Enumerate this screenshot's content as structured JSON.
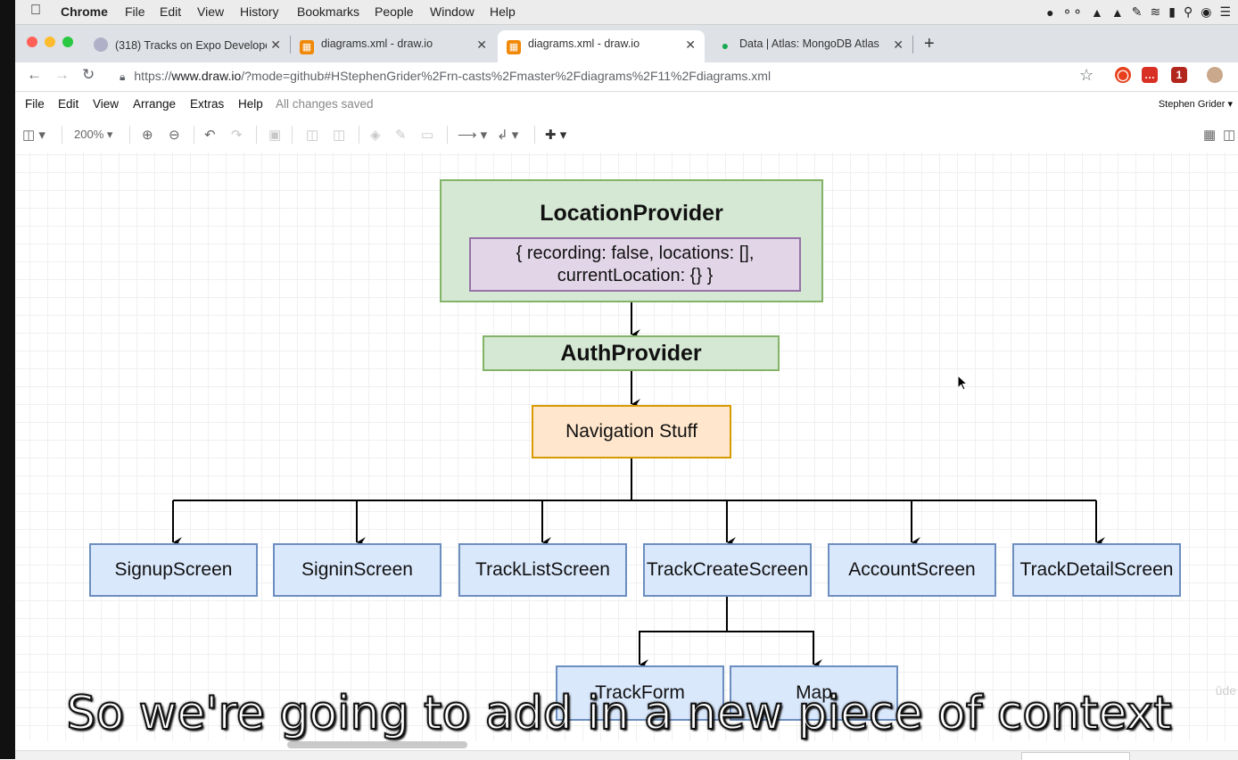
{
  "mac_menubar": {
    "app_name": "Chrome",
    "items": [
      "File",
      "Edit",
      "View",
      "History",
      "Bookmarks",
      "People",
      "Window",
      "Help"
    ]
  },
  "tabs": [
    {
      "title": "(318) Tracks on Expo Develope",
      "active": false
    },
    {
      "title": "diagrams.xml - draw.io",
      "active": false
    },
    {
      "title": "diagrams.xml - draw.io",
      "active": true
    },
    {
      "title": "Data | Atlas: MongoDB Atlas",
      "active": false
    }
  ],
  "address": {
    "scheme": "https://",
    "host": "www.draw.io",
    "path": "/?mode=github#HStephenGrider%2Frn-casts%2Fmaster%2Fdiagrams%2F11%2Fdiagrams.xml"
  },
  "drawio_menu": {
    "items": [
      "File",
      "Edit",
      "View",
      "Arrange",
      "Extras",
      "Help"
    ],
    "status": "All changes saved",
    "user": "Stephen Grider"
  },
  "toolbar": {
    "zoom": "200%"
  },
  "diagram": {
    "location_provider": {
      "title": "LocationProvider",
      "state_line1": "{ recording: false, locations: [],",
      "state_line2": "currentLocation: {} }"
    },
    "auth_provider": "AuthProvider",
    "navigation": "Navigation Stuff",
    "screens": [
      "SignupScreen",
      "SigninScreen",
      "TrackListScreen",
      "TrackCreateScreen",
      "AccountScreen",
      "TrackDetailScreen"
    ],
    "children": [
      "TrackForm",
      "Map"
    ]
  },
  "subtitle": "So we're going to add in a new piece of context",
  "watermark": "ûde",
  "colors": {
    "green_fill": "#d5e8d4",
    "green_stroke": "#82b366",
    "purple_fill": "#e1d5e7",
    "purple_stroke": "#9673a6",
    "orange_fill": "#ffe6cc",
    "orange_stroke": "#d79b00",
    "blue_fill": "#dae8fc",
    "blue_stroke": "#6c8ebf"
  }
}
